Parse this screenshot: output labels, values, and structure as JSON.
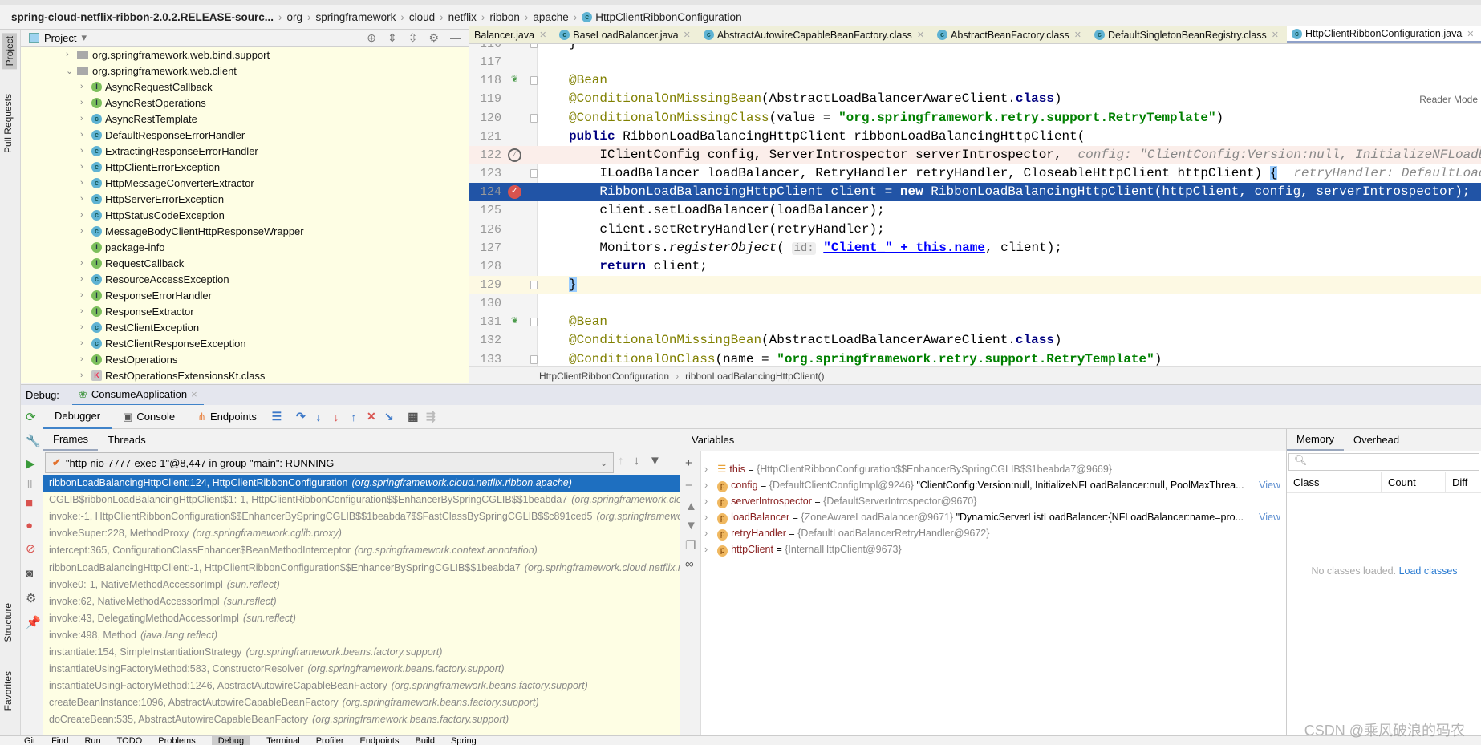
{
  "navbar": {
    "project": "spring-cloud-netflix-ribbon-2.0.2.RELEASE-sourc...",
    "crumbs": [
      "org",
      "springframework",
      "cloud",
      "netflix",
      "ribbon",
      "apache"
    ],
    "file": "HttpClientRibbonConfiguration"
  },
  "stripe": {
    "project": "Project",
    "pull_requests": "Pull Requests",
    "structure": "Structure",
    "favorites": "Favorites"
  },
  "project_panel": {
    "title": "Project",
    "packages": [
      {
        "label": "org.springframework.web.bind.support",
        "expanded": false
      },
      {
        "label": "org.springframework.web.client",
        "expanded": true
      }
    ],
    "items": [
      {
        "label": "AsyncRequestCallback",
        "kind": "interface",
        "deprecated": true
      },
      {
        "label": "AsyncRestOperations",
        "kind": "interface",
        "deprecated": true
      },
      {
        "label": "AsyncRestTemplate",
        "kind": "class",
        "deprecated": true
      },
      {
        "label": "DefaultResponseErrorHandler",
        "kind": "class"
      },
      {
        "label": "ExtractingResponseErrorHandler",
        "kind": "class"
      },
      {
        "label": "HttpClientErrorException",
        "kind": "class"
      },
      {
        "label": "HttpMessageConverterExtractor",
        "kind": "class"
      },
      {
        "label": "HttpServerErrorException",
        "kind": "class"
      },
      {
        "label": "HttpStatusCodeException",
        "kind": "class"
      },
      {
        "label": "MessageBodyClientHttpResponseWrapper",
        "kind": "class"
      },
      {
        "label": "package-info",
        "kind": "interface",
        "leaf": true
      },
      {
        "label": "RequestCallback",
        "kind": "interface"
      },
      {
        "label": "ResourceAccessException",
        "kind": "class"
      },
      {
        "label": "ResponseErrorHandler",
        "kind": "interface"
      },
      {
        "label": "ResponseExtractor",
        "kind": "interface"
      },
      {
        "label": "RestClientException",
        "kind": "class"
      },
      {
        "label": "RestClientResponseException",
        "kind": "class"
      },
      {
        "label": "RestOperations",
        "kind": "interface"
      },
      {
        "label": "RestOperationsExtensionsKt.class",
        "kind": "kotlin"
      }
    ]
  },
  "editor_tabs": [
    {
      "label": "Balancer.java",
      "active": false
    },
    {
      "label": "BaseLoadBalancer.java",
      "active": false
    },
    {
      "label": "AbstractAutowireCapableBeanFactory.class",
      "active": false
    },
    {
      "label": "AbstractBeanFactory.class",
      "active": false
    },
    {
      "label": "DefaultSingletonBeanRegistry.class",
      "active": false
    },
    {
      "label": "HttpClientRibbonConfiguration.java",
      "active": true
    }
  ],
  "editor": {
    "reader_mode": "Reader Mode",
    "lines": [
      {
        "n": "116",
        "tokens": [
          [
            "",
            "}"
          ]
        ]
      },
      {
        "n": "117",
        "tokens": []
      },
      {
        "n": "118",
        "icon": "bean",
        "tokens": [
          [
            "ann",
            "@Bean"
          ]
        ]
      },
      {
        "n": "119",
        "tokens": [
          [
            "ann",
            "@ConditionalOnMissingBean"
          ],
          [
            "",
            "(AbstractLoadBalancerAwareClient."
          ],
          [
            "kw",
            "class"
          ],
          [
            "",
            ")"
          ]
        ]
      },
      {
        "n": "120",
        "tokens": [
          [
            "ann",
            "@ConditionalOnMissingClass"
          ],
          [
            "",
            "(value = "
          ],
          [
            "str",
            "\"org.springframework.retry.support.RetryTemplate\""
          ],
          [
            "",
            ")"
          ]
        ]
      },
      {
        "n": "121",
        "tokens": [
          [
            "kw",
            "public "
          ],
          [
            "",
            "RibbonLoadBalancingHttpClient ribbonLoadBalancingHttpClient("
          ]
        ]
      },
      {
        "n": "122",
        "state": "warn",
        "icon": "muted-breakpoint",
        "tokens": [
          [
            "",
            "    IClientConfig config, ServerIntrospector serverIntrospector,"
          ]
        ],
        "hint": "config: \"ClientConfig:Version:null, InitializeNFLoadBalancer:null"
      },
      {
        "n": "123",
        "tokens": [
          [
            "",
            "    ILoadBalancer loadBalancer, RetryHandler retryHandler, CloseableHttpClient httpClient) "
          ],
          [
            "brace",
            "{"
          ]
        ],
        "hint": "retryHandler: DefaultLoadBalancerRetryHandler"
      },
      {
        "n": "124",
        "state": "sel",
        "icon": "breakpoint",
        "tokens": [
          [
            "",
            "    RibbonLoadBalancingHttpClient client = "
          ],
          [
            "kw",
            "new"
          ],
          [
            "",
            " RibbonLoadBalancingHttpClient(httpClient, config, serverIntrospector);"
          ]
        ]
      },
      {
        "n": "125",
        "tokens": [
          [
            "",
            "    client.setLoadBalancer(loadBalancer);"
          ]
        ]
      },
      {
        "n": "126",
        "tokens": [
          [
            "",
            "    client.setRetryHandler(retryHandler);"
          ]
        ]
      },
      {
        "n": "127",
        "tokens": [
          [
            "",
            "    Monitors."
          ],
          [
            "it",
            "registerObject"
          ],
          [
            "",
            "( "
          ],
          [
            "inlay",
            "id:"
          ],
          [
            "",
            " "
          ],
          [
            "link",
            "\"Client_\" + this.name"
          ],
          [
            "",
            ", client);"
          ]
        ]
      },
      {
        "n": "128",
        "tokens": [
          [
            "",
            "    "
          ],
          [
            "kw",
            "return"
          ],
          [
            "",
            " client;"
          ]
        ]
      },
      {
        "n": "129",
        "state": "cur",
        "tokens": [
          [
            "brace",
            "}"
          ]
        ]
      },
      {
        "n": "130",
        "tokens": []
      },
      {
        "n": "131",
        "icon": "bean",
        "tokens": [
          [
            "ann",
            "@Bean"
          ]
        ]
      },
      {
        "n": "132",
        "tokens": [
          [
            "ann",
            "@ConditionalOnMissingBean"
          ],
          [
            "",
            "(AbstractLoadBalancerAwareClient."
          ],
          [
            "kw",
            "class"
          ],
          [
            "",
            ")"
          ]
        ]
      },
      {
        "n": "133",
        "tokens": [
          [
            "ann",
            "@ConditionalOnClass"
          ],
          [
            "",
            "(name = "
          ],
          [
            "str",
            "\"org.springframework.retry.support.RetryTemplate\""
          ],
          [
            "",
            ")"
          ]
        ]
      }
    ],
    "breadcrumb": [
      "HttpClientRibbonConfiguration",
      "ribbonLoadBalancingHttpClient()"
    ]
  },
  "debug": {
    "label": "Debug:",
    "session": "ConsumeApplication",
    "tabs": [
      "Debugger",
      "Console",
      "Endpoints"
    ],
    "frames_tabs": [
      "Frames",
      "Threads"
    ],
    "thread": "\"http-nio-7777-exec-1\"@8,447 in group \"main\": RUNNING",
    "frames": [
      {
        "method": "ribbonLoadBalancingHttpClient:124, HttpClientRibbonConfiguration",
        "pkg": "(org.springframework.cloud.netflix.ribbon.apache)",
        "selected": true
      },
      {
        "method": "CGLIB$ribbonLoadBalancingHttpClient$1:-1, HttpClientRibbonConfiguration$$EnhancerBySpringCGLIB$$1beabda7",
        "pkg": "(org.springframework.cloud.netflix.ribbon.apache)"
      },
      {
        "method": "invoke:-1, HttpClientRibbonConfiguration$$EnhancerBySpringCGLIB$$1beabda7$$FastClassBySpringCGLIB$$c891ced5",
        "pkg": "(org.springframework.cloud.netflix.ribbon.apache)"
      },
      {
        "method": "invokeSuper:228, MethodProxy",
        "pkg": "(org.springframework.cglib.proxy)"
      },
      {
        "method": "intercept:365, ConfigurationClassEnhancer$BeanMethodInterceptor",
        "pkg": "(org.springframework.context.annotation)"
      },
      {
        "method": "ribbonLoadBalancingHttpClient:-1, HttpClientRibbonConfiguration$$EnhancerBySpringCGLIB$$1beabda7",
        "pkg": "(org.springframework.cloud.netflix.ribbon.apache)"
      },
      {
        "method": "invoke0:-1, NativeMethodAccessorImpl",
        "pkg": "(sun.reflect)"
      },
      {
        "method": "invoke:62, NativeMethodAccessorImpl",
        "pkg": "(sun.reflect)"
      },
      {
        "method": "invoke:43, DelegatingMethodAccessorImpl",
        "pkg": "(sun.reflect)"
      },
      {
        "method": "invoke:498, Method",
        "pkg": "(java.lang.reflect)"
      },
      {
        "method": "instantiate:154, SimpleInstantiationStrategy",
        "pkg": "(org.springframework.beans.factory.support)"
      },
      {
        "method": "instantiateUsingFactoryMethod:583, ConstructorResolver",
        "pkg": "(org.springframework.beans.factory.support)"
      },
      {
        "method": "instantiateUsingFactoryMethod:1246, AbstractAutowireCapableBeanFactory",
        "pkg": "(org.springframework.beans.factory.support)"
      },
      {
        "method": "createBeanInstance:1096, AbstractAutowireCapableBeanFactory",
        "pkg": "(org.springframework.beans.factory.support)"
      },
      {
        "method": "doCreateBean:535, AbstractAutowireCapableBeanFactory",
        "pkg": "(org.springframework.beans.factory.support)"
      }
    ],
    "variables_title": "Variables",
    "variables": [
      {
        "name": "this",
        "kind": "this",
        "type": "{HttpClientRibbonConfiguration$$EnhancerBySpringCGLIB$$1beabda7@9669}",
        "value": "",
        "view": ""
      },
      {
        "name": "config",
        "kind": "p",
        "type": "{DefaultClientConfigImpl@9246}",
        "value": "\"ClientConfig:Version:null, InitializeNFLoadBalancer:null, PoolMaxThrea...",
        "view": "View"
      },
      {
        "name": "serverIntrospector",
        "kind": "p",
        "type": "{DefaultServerIntrospector@9670}",
        "value": "",
        "view": ""
      },
      {
        "name": "loadBalancer",
        "kind": "p",
        "type": "{ZoneAwareLoadBalancer@9671}",
        "value": "\"DynamicServerListLoadBalancer:{NFLoadBalancer:name=pro...",
        "view": "View"
      },
      {
        "name": "retryHandler",
        "kind": "p",
        "type": "{DefaultLoadBalancerRetryHandler@9672}",
        "value": "",
        "view": ""
      },
      {
        "name": "httpClient",
        "kind": "p",
        "type": "{InternalHttpClient@9673}",
        "value": "",
        "view": ""
      }
    ],
    "memory": {
      "tabs": [
        "Memory",
        "Overhead"
      ],
      "columns": [
        "Class",
        "Count",
        "Diff"
      ],
      "empty": "No classes loaded.",
      "load": "Load classes"
    }
  },
  "bottom_bar": [
    "Git",
    "Find",
    "Run",
    "TODO",
    "Problems",
    "Debug",
    "Terminal",
    "Profiler",
    "Endpoints",
    "Build",
    "Spring"
  ],
  "bottom_active": "Debug",
  "watermark": "CSDN @乘风破浪的码农"
}
